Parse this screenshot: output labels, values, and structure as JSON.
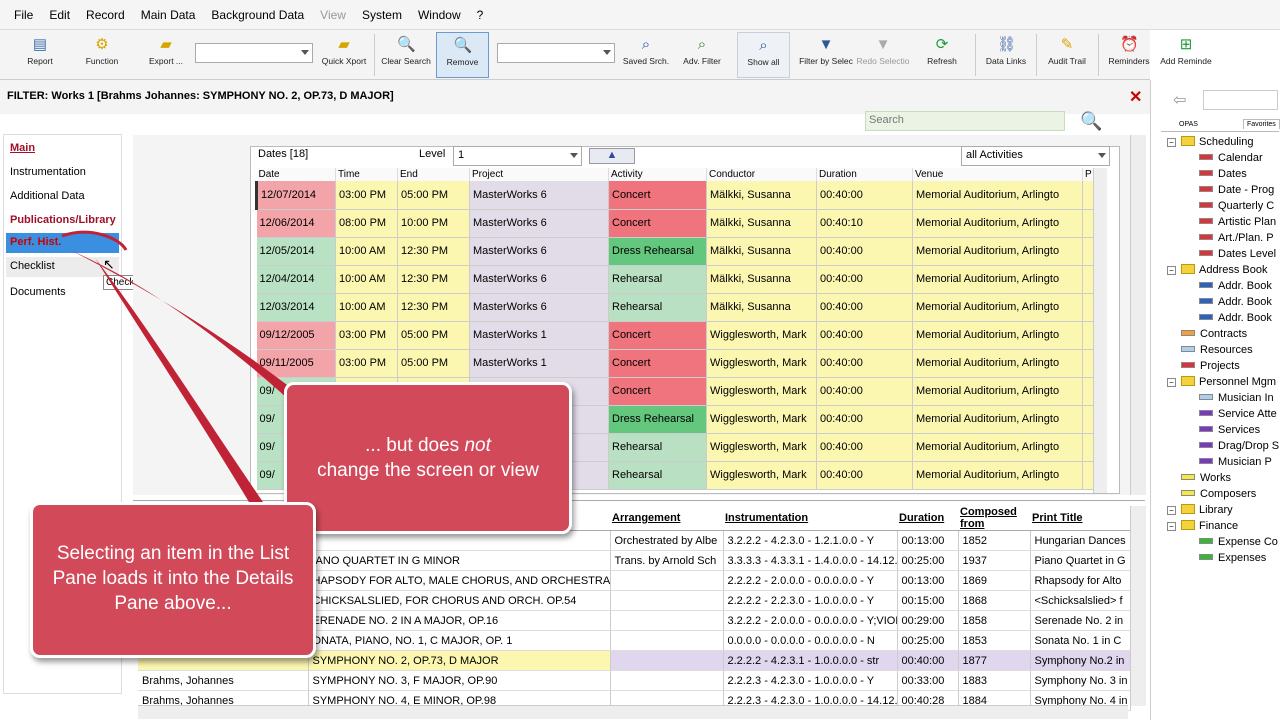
{
  "menu": [
    "File",
    "Edit",
    "Record",
    "Main Data",
    "Background Data",
    "View",
    "System",
    "Window",
    "?"
  ],
  "toolbar": {
    "report": "Report",
    "function": "Function",
    "export": "Export ...",
    "quick_export": "Quick Xport",
    "clear_search": "Clear Search",
    "remove": "Remove",
    "saved_search": "Saved Srch.",
    "adv_filter": "Adv. Filter",
    "show_all": "Show all",
    "filter_by_sel": "Filter by Selec",
    "redo_sel": "Redo Selectio",
    "refresh": "Refresh",
    "data_links": "Data Links",
    "audit_trail": "Audit Trail",
    "reminders": "Reminders",
    "add_reminder": "Add Reminde"
  },
  "filter": {
    "text": "FILTER: Works  1 [Brahms Johannes: SYMPHONY NO.  2, OP.73, D MAJOR]",
    "close": "✕"
  },
  "search": {
    "placeholder": "Search"
  },
  "nav": {
    "main": "Main",
    "instrumentation": "Instrumentation",
    "additional": "Additional Data",
    "publications": "Publications/Library",
    "perf_hist": "Perf. Hist.",
    "checklist": "Checklist",
    "documents": "Documents",
    "tooltip": "Checklist"
  },
  "dates": {
    "label": "Dates  [18]",
    "level_label": "Level",
    "level_value": "1",
    "activity_filter": "all Activities",
    "columns": [
      "Date",
      "Time",
      "End",
      "Project",
      "Activity",
      "Conductor",
      "Duration",
      "Venue",
      "P"
    ],
    "rows": [
      [
        "12/07/2014",
        "03:00 PM",
        "05:00 PM",
        "MasterWorks  6",
        "Concert",
        "Mälkki,  Susanna",
        "00:40:00",
        "Memorial Auditorium, Arlingto"
      ],
      [
        "12/06/2014",
        "08:00 PM",
        "10:00 PM",
        "MasterWorks  6",
        "Concert",
        "Mälkki,  Susanna",
        "00:40:10",
        "Memorial Auditorium, Arlingto"
      ],
      [
        "12/05/2014",
        "10:00 AM",
        "12:30 PM",
        "MasterWorks  6",
        "Dress Rehearsal",
        "Mälkki,  Susanna",
        "00:40:00",
        "Memorial Auditorium, Arlingto"
      ],
      [
        "12/04/2014",
        "10:00 AM",
        "12:30 PM",
        "MasterWorks  6",
        "Rehearsal",
        "Mälkki,  Susanna",
        "00:40:00",
        "Memorial Auditorium, Arlingto"
      ],
      [
        "12/03/2014",
        "10:00 AM",
        "12:30 PM",
        "MasterWorks  6",
        "Rehearsal",
        "Mälkki,  Susanna",
        "00:40:00",
        "Memorial Auditorium, Arlingto"
      ],
      [
        "09/12/2005",
        "03:00 PM",
        "05:00 PM",
        "MasterWorks  1",
        "Concert",
        "Wigglesworth, Mark",
        "00:40:00",
        "Memorial Auditorium, Arlingto"
      ],
      [
        "09/11/2005",
        "03:00 PM",
        "05:00 PM",
        "MasterWorks  1",
        "Concert",
        "Wigglesworth, Mark",
        "00:40:00",
        "Memorial Auditorium, Arlingto"
      ],
      [
        "09/",
        "",
        "",
        "",
        "Concert",
        "Wigglesworth, Mark",
        "00:40:00",
        "Memorial Auditorium, Arlingto"
      ],
      [
        "09/",
        "",
        "",
        "",
        "Dress Rehearsal",
        "Wigglesworth, Mark",
        "00:40:00",
        "Memorial Auditorium, Arlingto"
      ],
      [
        "09/",
        "",
        "",
        "",
        "Rehearsal",
        "Wigglesworth, Mark",
        "00:40:00",
        "Memorial Auditorium, Arlingto"
      ],
      [
        "09/",
        "",
        "",
        "",
        "Rehearsal",
        "Wigglesworth, Mark",
        "00:40:00",
        "Memorial Auditorium, Arlingto"
      ]
    ]
  },
  "works": {
    "columns": [
      "",
      "",
      "Arrangement",
      "Instrumentation",
      "Duration",
      "Composed from",
      "Print Title"
    ],
    "rows": [
      [
        "",
        "",
        "Orchestrated by Albe",
        "3.2.2.2 - 4.2.3.0 - 1.2.1.0.0 - Y",
        "00:13:00",
        "1852",
        "Hungarian Dances"
      ],
      [
        "",
        "IANO QUARTET IN G MINOR",
        "Trans. by Arnold Sch",
        "3.3.3.3 - 4.3.3.1 - 1.4.0.0.0 - 14.12.",
        "00:25:00",
        "1937",
        "Piano Quartet in G"
      ],
      [
        "",
        "HAPSODY FOR ALTO, MALE CHORUS, AND ORCHESTRA",
        "",
        "2.2.2.2 - 2.0.0.0 - 0.0.0.0.0 - Y",
        "00:13:00",
        "1869",
        "Rhapsody for Alto"
      ],
      [
        "",
        "CHICKSALSLIED, FOR CHORUS AND ORCH. OP.54",
        "",
        "2.2.2.2 - 2.2.3.0 - 1.0.0.0.0 - Y",
        "00:15:00",
        "1868",
        "&lt;Schicksalslied&gt; f"
      ],
      [
        "",
        "ERENADE NO.  2 IN A MAJOR, OP.16",
        "",
        "3.2.2.2 - 2.0.0.0 - 0.0.0.0.0 - Y;VIOL",
        "00:29:00",
        "1858",
        "Serenade No. 2 in"
      ],
      [
        "",
        "ONATA, PIANO, NO. 1, C MAJOR, OP. 1",
        "",
        "0.0.0.0 - 0.0.0.0 - 0.0.0.0.0 - N",
        "00:25:00",
        "1853",
        "Sonata No. 1 in C"
      ],
      [
        "",
        "SYMPHONY NO.  2, OP.73, D MAJOR",
        "",
        "2.2.2.2 - 4.2.3.1 - 1.0.0.0.0 - str",
        "00:40:00",
        "1877",
        "Symphony No.2 in"
      ],
      [
        "Brahms, Johannes",
        "SYMPHONY NO.  3, F MAJOR, OP.90",
        "",
        "2.2.2.3 - 4.2.3.0 - 1.0.0.0.0 - Y",
        "00:33:00",
        "1883",
        "Symphony No. 3 in"
      ],
      [
        "Brahms, Johannes",
        "SYMPHONY NO.  4, E MINOR, OP.98",
        "",
        "2.2.2.3 - 4.2.3.0 - 1.0.0.0.0 - 14.12.",
        "00:40:28",
        "1884",
        "Symphony No. 4 in"
      ]
    ]
  },
  "callouts": {
    "top": "... but does not change the screen or view",
    "top_a": "... but does ",
    "top_em": "not",
    "top_b": " change the screen or view",
    "bottom": "Selecting an item in the List Pane loads it into the Details Pane above..."
  },
  "tree": {
    "tabs": [
      "OPAS",
      "Favorites"
    ],
    "items": [
      {
        "label": "Scheduling",
        "type": "folder",
        "level": 0
      },
      {
        "label": "Calendar",
        "type": "red",
        "level": 1
      },
      {
        "label": "Dates",
        "type": "red",
        "level": 1
      },
      {
        "label": "Date - Prog",
        "type": "red",
        "level": 1
      },
      {
        "label": "Quarterly C",
        "type": "red",
        "level": 1
      },
      {
        "label": "Artistic Plan",
        "type": "red",
        "level": 1
      },
      {
        "label": "Art./Plan. P",
        "type": "red",
        "level": 1
      },
      {
        "label": "Dates Level",
        "type": "red",
        "level": 1
      },
      {
        "label": "Address Book",
        "type": "folder",
        "level": 0
      },
      {
        "label": "Addr. Book",
        "type": "blue",
        "level": 1
      },
      {
        "label": "Addr. Book",
        "type": "blue",
        "level": 1
      },
      {
        "label": "Addr. Book",
        "type": "blue",
        "level": 1
      },
      {
        "label": "Contracts",
        "type": "orange",
        "level": 0
      },
      {
        "label": "Resources",
        "type": "lightblue",
        "level": 0
      },
      {
        "label": "Projects",
        "type": "red",
        "level": 0
      },
      {
        "label": "Personnel Mgm",
        "type": "folder",
        "level": 0
      },
      {
        "label": "Musician In",
        "type": "lightblue",
        "level": 1
      },
      {
        "label": "Service Atte",
        "type": "purple",
        "level": 1
      },
      {
        "label": "Services",
        "type": "purple",
        "level": 1
      },
      {
        "label": "Drag/Drop S",
        "type": "purple",
        "level": 1
      },
      {
        "label": "Musician P",
        "type": "purple",
        "level": 1
      },
      {
        "label": "Works",
        "type": "yellow",
        "level": 0
      },
      {
        "label": "Composers",
        "type": "yellow",
        "level": 0
      },
      {
        "label": "Library",
        "type": "folder",
        "level": 0
      },
      {
        "label": "Finance",
        "type": "folder",
        "level": 0
      },
      {
        "label": "Expense Co",
        "type": "green",
        "level": 1
      },
      {
        "label": "Expenses",
        "type": "green",
        "level": 1
      }
    ]
  }
}
